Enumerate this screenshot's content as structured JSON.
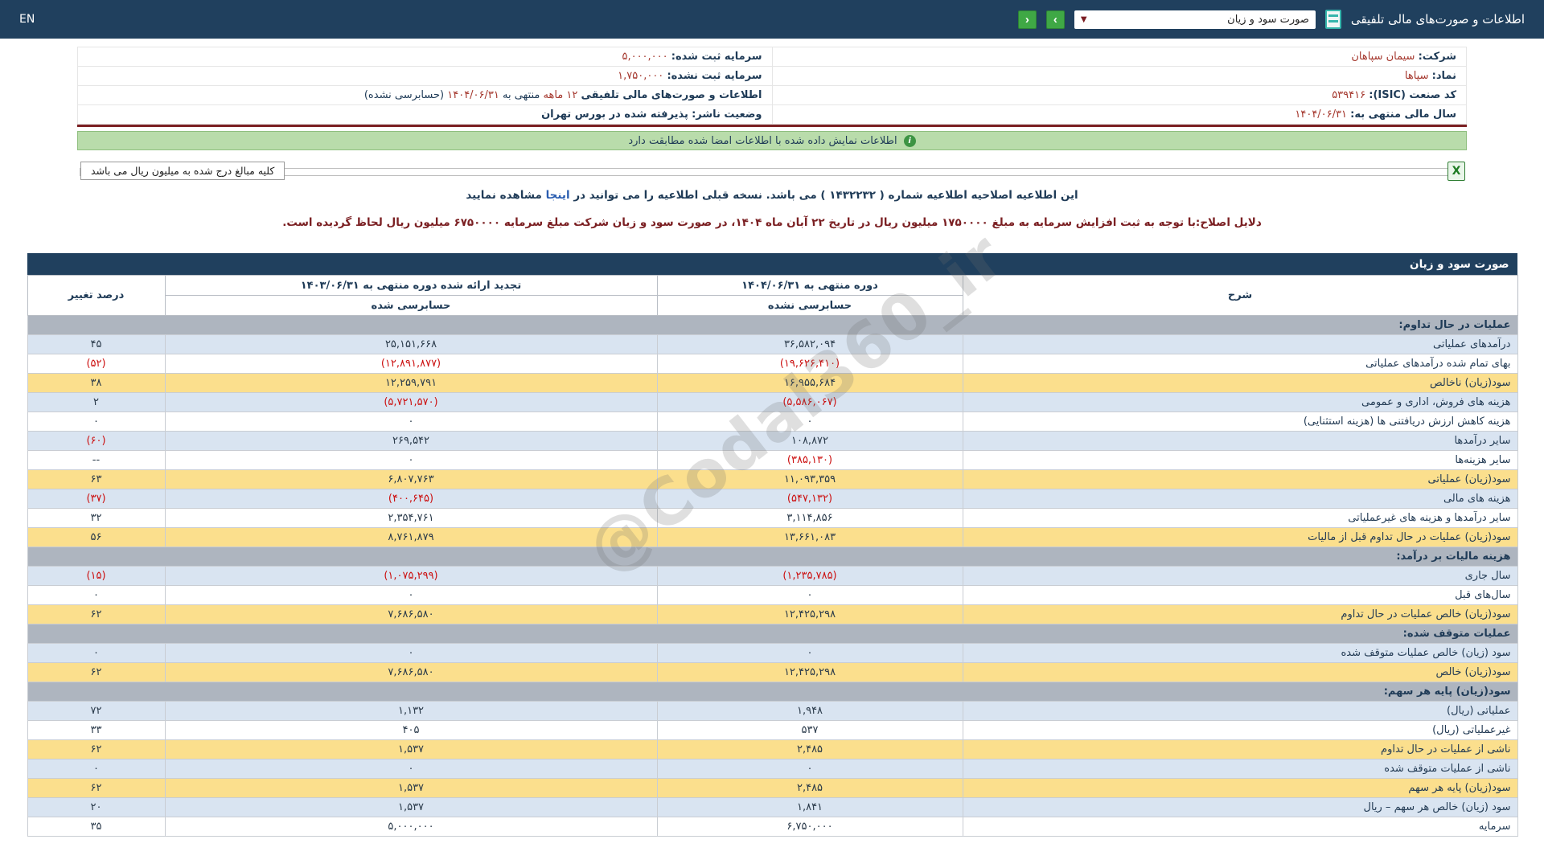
{
  "navbar": {
    "en": "EN",
    "title": "اطلاعات و صورت‌های مالی تلفیقی",
    "dropdown_value": "صورت سود و زیان",
    "dropdown_caret": "▼",
    "next_label": "›",
    "prev_label": "‹"
  },
  "company": {
    "company_label": "شرکت:",
    "company_value": "سیمان سپاهان",
    "symbol_label": "نماد:",
    "symbol_value": "سپاها",
    "isic_label": "کد صنعت (ISIC):",
    "isic_value": "۵۳۹۴۱۶",
    "fiscal_label": "سال مالی منتهی به:",
    "fiscal_value": "۱۴۰۴/۰۶/۳۱",
    "reg_capital_label": "سرمایه ثبت شده:",
    "reg_capital_value": "۵,۰۰۰,۰۰۰",
    "unreg_capital_label": "سرمایه ثبت نشده:",
    "unreg_capital_value": "۱,۷۵۰,۰۰۰",
    "report_label": "اطلاعات و صورت‌های مالی تلفیقی",
    "report_period": "۱۲ ماهه",
    "report_mid": "منتهی به",
    "report_date": "۱۴۰۴/۰۶/۳۱",
    "report_suffix": "(حسابرسی نشده)",
    "status_label": "وضعیت ناشر:",
    "status_value": "پذیرفته شده در بورس تهران"
  },
  "banner": {
    "text": "اطلاعات نمایش داده شده با اطلاعات امضا شده مطابقت دارد",
    "icon": "i"
  },
  "amounts": {
    "label": "کلیه مبالغ درج شده به میلیون ریال می باشد",
    "excel_glyph": "X"
  },
  "notice": {
    "prefix": "این اطلاعیه اصلاحیه اطلاعیه شماره ( ۱۴۳۲۲۳۲ ) می باشد. نسخه قبلی اطلاعیه را می توانید در",
    "link": "اینجا",
    "suffix": "مشاهده نمایید"
  },
  "correction": {
    "text": "دلایل اصلاح:با توجه به ثبت افزایش سرمایه به مبلغ ۱۷۵۰۰۰۰ میلیون ریال در تاریخ ۲۲ آبان ماه ۱۴۰۴، در صورت سود و زیان شرکت مبلغ سرمایه ۶۷۵۰۰۰۰ میلیون ریال لحاظ گردیده است."
  },
  "watermark": {
    "text": "@Codal360_ir"
  },
  "colors": {
    "navy": "#20405e",
    "green_button": "#3fa845",
    "banner_green": "#b9dcab",
    "yellow_row": "#fbdf8d",
    "blue_row": "#d9e4f1",
    "section_row": "#aeb5bf",
    "negative_red": "#cc1111",
    "link_red": "#a5382e",
    "divider_maroon": "#7b2023"
  },
  "statement": {
    "title": "صورت سود و زیان",
    "col_desc": "شرح",
    "col_current": "دوره منتهی به ۱۴۰۴/۰۶/۳۱",
    "col_current_sub": "حسابرسی نشده",
    "col_prior": "تجدید ارائه شده دوره منتهی به ۱۴۰۳/۰۶/۳۱",
    "col_prior_sub": "حسابرسی شده",
    "col_pct": "درصد تغییر",
    "rows": [
      {
        "type": "section",
        "label": "عملیات در حال تداوم:"
      },
      {
        "type": "data",
        "style": "blue",
        "label": "درآمدهای عملیاتی",
        "v1404": "۳۶,۵۸۲,۰۹۴",
        "v1403": "۲۵,۱۵۱,۶۶۸",
        "pct": "۴۵"
      },
      {
        "type": "data",
        "style": "white",
        "label": "بهای تمام شده درآمدهای عملیاتی",
        "v1404": "(۱۹,۶۲۶,۴۱۰)",
        "v1403": "(۱۲,۸۹۱,۸۷۷)",
        "pct": "(۵۲)"
      },
      {
        "type": "data",
        "style": "yellow",
        "label": "سود(زیان) ناخالص",
        "v1404": "۱۶,۹۵۵,۶۸۴",
        "v1403": "۱۲,۲۵۹,۷۹۱",
        "pct": "۳۸"
      },
      {
        "type": "data",
        "style": "blue",
        "label": "هزینه های فروش، اداری و عمومی",
        "v1404": "(۵,۵۸۶,۰۶۷)",
        "v1403": "(۵,۷۲۱,۵۷۰)",
        "pct": "۲"
      },
      {
        "type": "data",
        "style": "white",
        "label": "هزینه کاهش ارزش دریافتنی ها (هزینه استثنایی)",
        "v1404": "۰",
        "v1403": "۰",
        "pct": "۰"
      },
      {
        "type": "data",
        "style": "blue",
        "label": "سایر درآمدها",
        "v1404": "۱۰۸,۸۷۲",
        "v1403": "۲۶۹,۵۴۲",
        "pct": "(۶۰)"
      },
      {
        "type": "data",
        "style": "white",
        "label": "سایر هزینه‌ها",
        "v1404": "(۳۸۵,۱۳۰)",
        "v1403": "۰",
        "pct": "--"
      },
      {
        "type": "data",
        "style": "yellow",
        "label": "سود(زیان) عملیاتی",
        "v1404": "۱۱,۰۹۳,۳۵۹",
        "v1403": "۶,۸۰۷,۷۶۳",
        "pct": "۶۳"
      },
      {
        "type": "data",
        "style": "blue",
        "label": "هزینه های مالی",
        "v1404": "(۵۴۷,۱۳۲)",
        "v1403": "(۴۰۰,۶۴۵)",
        "pct": "(۳۷)"
      },
      {
        "type": "data",
        "style": "white",
        "label": "سایر درآمدها و هزینه های غیرعملیاتی",
        "v1404": "۳,۱۱۴,۸۵۶",
        "v1403": "۲,۳۵۴,۷۶۱",
        "pct": "۳۲"
      },
      {
        "type": "data",
        "style": "yellow",
        "label": "سود(زیان) عملیات در حال تداوم قبل از مالیات",
        "v1404": "۱۳,۶۶۱,۰۸۳",
        "v1403": "۸,۷۶۱,۸۷۹",
        "pct": "۵۶"
      },
      {
        "type": "section",
        "label": "هزینه مالیات بر درآمد:"
      },
      {
        "type": "data",
        "style": "blue",
        "label": "سال جاری",
        "v1404": "(۱,۲۳۵,۷۸۵)",
        "v1403": "(۱,۰۷۵,۲۹۹)",
        "pct": "(۱۵)"
      },
      {
        "type": "data",
        "style": "white",
        "label": "سال‌های قبل",
        "v1404": "۰",
        "v1403": "۰",
        "pct": "۰"
      },
      {
        "type": "data",
        "style": "yellow",
        "label": "سود(زیان) خالص عملیات در حال تداوم",
        "v1404": "۱۲,۴۲۵,۲۹۸",
        "v1403": "۷,۶۸۶,۵۸۰",
        "pct": "۶۲"
      },
      {
        "type": "section",
        "label": "عملیات متوقف شده:"
      },
      {
        "type": "data",
        "style": "blue",
        "label": "سود (زیان) خالص عملیات متوقف شده",
        "v1404": "۰",
        "v1403": "۰",
        "pct": "۰"
      },
      {
        "type": "data",
        "style": "yellow",
        "label": "سود(زیان) خالص",
        "v1404": "۱۲,۴۲۵,۲۹۸",
        "v1403": "۷,۶۸۶,۵۸۰",
        "pct": "۶۲"
      },
      {
        "type": "section",
        "label": "سود(زیان) پایه هر سهم:"
      },
      {
        "type": "data",
        "style": "blue",
        "label": "عملیاتی (ریال)",
        "v1404": "۱,۹۴۸",
        "v1403": "۱,۱۳۲",
        "pct": "۷۲"
      },
      {
        "type": "data",
        "style": "white",
        "label": "غیرعملیاتی (ریال)",
        "v1404": "۵۳۷",
        "v1403": "۴۰۵",
        "pct": "۳۳"
      },
      {
        "type": "data",
        "style": "yellow",
        "label": "ناشی از عملیات در حال تداوم",
        "v1404": "۲,۴۸۵",
        "v1403": "۱,۵۳۷",
        "pct": "۶۲"
      },
      {
        "type": "data",
        "style": "blue",
        "label": "ناشی از عملیات متوقف شده",
        "v1404": "۰",
        "v1403": "۰",
        "pct": "۰"
      },
      {
        "type": "data",
        "style": "yellow",
        "label": "سود(زیان) پایه هر سهم",
        "v1404": "۲,۴۸۵",
        "v1403": "۱,۵۳۷",
        "pct": "۶۲"
      },
      {
        "type": "data",
        "style": "blue",
        "label": "سود (زیان) خالص هر سهم – ریال",
        "v1404": "۱,۸۴۱",
        "v1403": "۱,۵۳۷",
        "pct": "۲۰"
      },
      {
        "type": "data",
        "style": "white",
        "label": "سرمایه",
        "v1404": "۶,۷۵۰,۰۰۰",
        "v1403": "۵,۰۰۰,۰۰۰",
        "pct": "۳۵"
      }
    ]
  }
}
